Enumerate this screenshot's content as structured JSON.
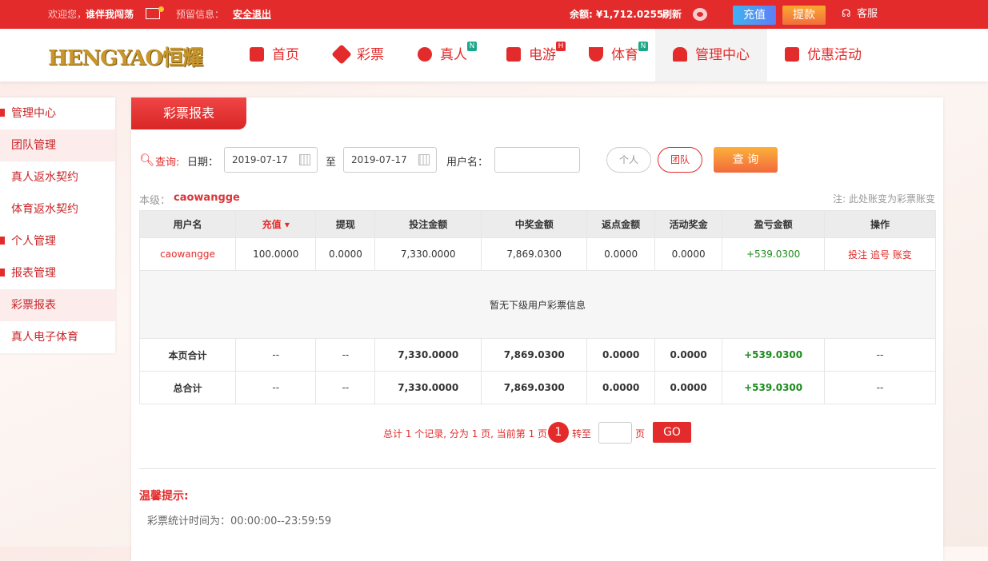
{
  "topbar": {
    "welcome": "欢迎您，",
    "username": "谁伴我闯荡",
    "reserved": "预留信息：",
    "logout": "安全退出",
    "balance_label": "余额:",
    "balance": "¥1,712.0255",
    "refresh": "刷新",
    "deposit": "充值",
    "withdraw": "提款",
    "service": "客服"
  },
  "logo": "HENGYAO恒耀",
  "nav": [
    {
      "label": "首页"
    },
    {
      "label": "彩票"
    },
    {
      "label": "真人",
      "badge": "N"
    },
    {
      "label": "电游",
      "badge": "H"
    },
    {
      "label": "体育",
      "badge": "N"
    },
    {
      "label": "管理中心"
    },
    {
      "label": "优惠活动"
    }
  ],
  "sidebar": [
    "管理中心",
    "团队管理",
    "真人返水契约",
    "体育返水契约",
    "个人管理",
    "报表管理",
    "彩票报表",
    "真人电子体育"
  ],
  "main": {
    "tab": "彩票报表",
    "query": "查询:",
    "date_label": "日期：",
    "date_from": "2019-07-17",
    "to": "至",
    "date_to": "2019-07-17",
    "user_label": "用户名：",
    "user_value": "",
    "personal": "个人",
    "team": "团队",
    "search": "查 询",
    "level_label": "本级：",
    "level_user": "caowangge",
    "note": "注: 此处账变为彩票账变"
  },
  "table": {
    "headers": [
      "用户名",
      "充值",
      "提现",
      "投注金额",
      "中奖金额",
      "返点金额",
      "活动奖金",
      "盈亏金额",
      "操作"
    ],
    "row": [
      "caowangge",
      "100.0000",
      "0.0000",
      "7,330.0000",
      "7,869.0300",
      "0.0000",
      "0.0000",
      "+539.0300"
    ],
    "actions": [
      "投注",
      "追号",
      "账变"
    ],
    "empty": "暂无下级用户彩票信息",
    "page_total": [
      "本页合计",
      "--",
      "--",
      "7,330.0000",
      "7,869.0300",
      "0.0000",
      "0.0000",
      "+539.0300",
      "--"
    ],
    "grand_total": [
      "总合计",
      "--",
      "--",
      "7,330.0000",
      "7,869.0300",
      "0.0000",
      "0.0000",
      "+539.0300",
      "--"
    ]
  },
  "pager": {
    "info": "总计 1 个记录, 分为 1 页, 当前第 1 页",
    "current": "1",
    "goto": "转至",
    "page": "页",
    "go": "GO"
  },
  "tips": {
    "title": "温馨提示:",
    "text": "彩票统计时间为：00:00:00--23:59:59"
  }
}
